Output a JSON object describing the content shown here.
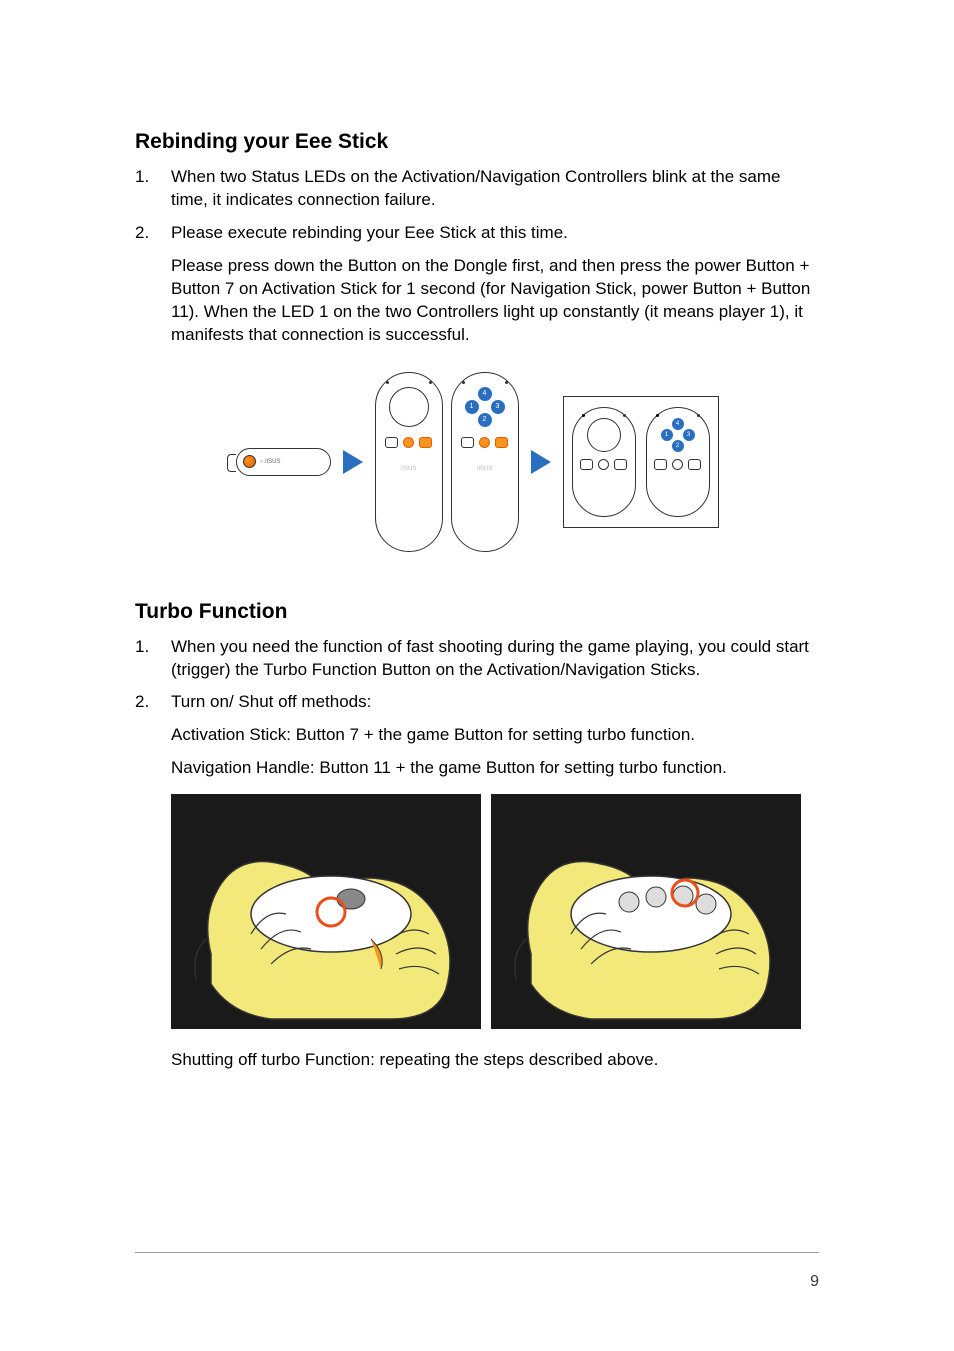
{
  "section1": {
    "title": "Rebinding your Eee Stick",
    "items": [
      {
        "num": "1.",
        "text": "When two Status LEDs on the Activation/Navigation Controllers blink at the same time, it indicates connection failure."
      },
      {
        "num": "2.",
        "text": "Please execute rebinding your Eee Stick at this time.",
        "sub": "Please press down the Button on the Dongle first, and then press the power Button + Button 7 on Activation Stick for 1 second (for Navigation Stick, power Button + Button 11). When the LED 1 on the two Controllers light up constantly (it means player 1), it manifests that connection is successful."
      }
    ]
  },
  "section2": {
    "title": "Turbo Function",
    "items": [
      {
        "num": "1.",
        "text": "When you need the function of fast shooting during the game playing, you could start (trigger) the Turbo Function Button on the Activation/Navigation Sticks."
      },
      {
        "num": "2.",
        "text": "Turn on/ Shut off methods:",
        "subA": "Activation Stick: Button 7 + the game Button for setting turbo function.",
        "subB": "Navigation Handle: Button 11 + the game Button for setting turbo function."
      }
    ],
    "closing": "Shutting off turbo Function: repeating the steps described above."
  },
  "diagram": {
    "dpad": {
      "up": "4",
      "down": "2",
      "left": "1",
      "right": "3"
    },
    "dongle_label": "○ /ISUS",
    "brand": "/ISUS"
  },
  "page_number": "9"
}
